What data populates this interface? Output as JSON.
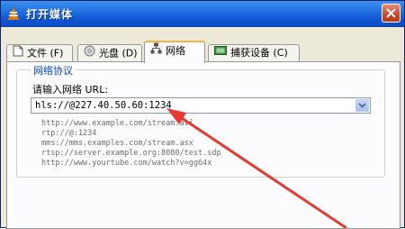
{
  "window": {
    "title": "打开媒体"
  },
  "tabs": [
    {
      "label": "文件 (F)",
      "icon": "file-icon",
      "active": false
    },
    {
      "label": "光盘 (D)",
      "icon": "disc-icon",
      "active": false
    },
    {
      "label": "网络",
      "icon": "network-icon",
      "active": true
    },
    {
      "label": "捕获设备 (C)",
      "icon": "capture-icon",
      "active": false
    }
  ],
  "network": {
    "group_title": "网络协议",
    "url_label": "请输入网络 URL:",
    "url_value": "hls://@227.40.50.60:1234",
    "examples": [
      "http://www.example.com/stream.avi",
      "rtp://@:1234",
      "mms://mms.examples.com/stream.asx",
      "rtsp://server.example.org:8080/test.sdp",
      "http://www.yourtube.com/watch?v=gg64x"
    ]
  },
  "colors": {
    "titlebar": "#0a4fc9",
    "group_title": "#0046d5",
    "annotation_arrow": "#e8382f",
    "active_tab_accent": "#f7b33b"
  }
}
